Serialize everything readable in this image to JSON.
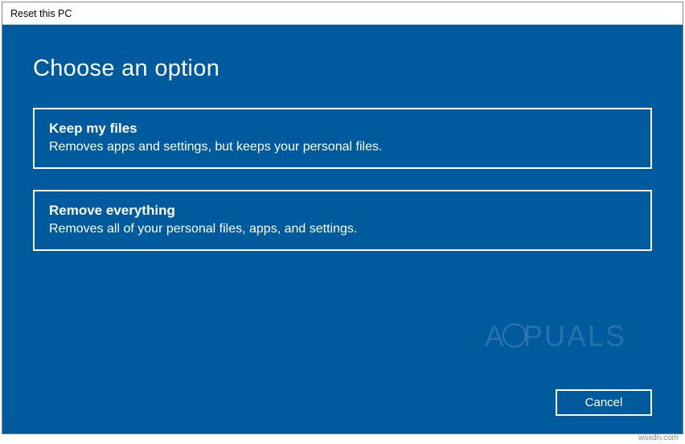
{
  "window": {
    "title": "Reset this PC"
  },
  "heading": "Choose an option",
  "options": [
    {
      "title": "Keep my files",
      "desc": "Removes apps and settings, but keeps your personal files."
    },
    {
      "title": "Remove everything",
      "desc": "Removes all of your personal files, apps, and settings."
    }
  ],
  "footer": {
    "cancel": "Cancel"
  },
  "watermark": "A  PUALS",
  "credit": "wsxdn.com"
}
